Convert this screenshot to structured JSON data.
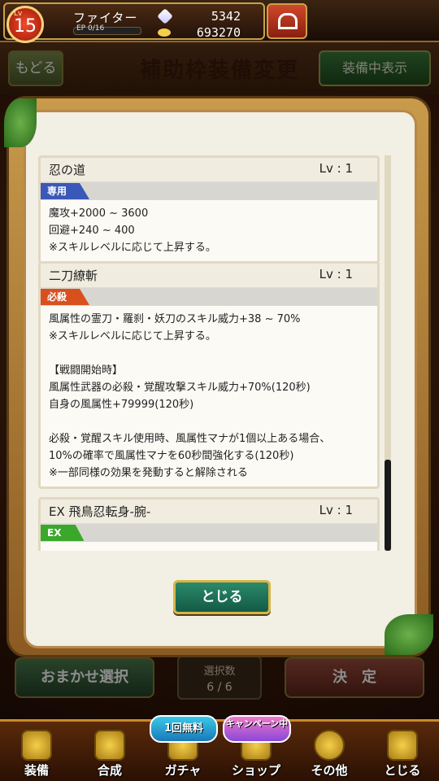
{
  "player": {
    "level_tag": "Lv",
    "level": "15",
    "job": "ファイター",
    "ep_label": "EP",
    "ep_value": "0/16",
    "ep_fraction": 0,
    "gems": "5342",
    "coins": "693270"
  },
  "header": {
    "back_label": "もどる",
    "title": "補助枠装備変更",
    "equipped_toggle_label": "装備中表示"
  },
  "selection": {
    "auto_select_label": "おまかせ選択",
    "count_label": "選択数",
    "count_value": "6 / 6",
    "confirm_label": "決　定"
  },
  "modal": {
    "close_label": "とじる",
    "skills": [
      {
        "name": "忍の道",
        "level": "Lv : 1",
        "type": "専用",
        "type_color": "#3a58b8",
        "lines": [
          "魔攻+2000 ~ 3600",
          "回避+240 ~ 400",
          "※スキルレベルに応じて上昇する。"
        ]
      },
      {
        "name": "二刀繚斬",
        "level": "Lv : 1",
        "type": "必殺",
        "type_color": "#d8501e",
        "lines": [
          "風属性の霊刀・羅刹・妖刀のスキル威力+38 ~ 70%",
          "※スキルレベルに応じて上昇する。",
          "",
          "【戦闘開始時】",
          "風属性武器の必殺・覚醒攻撃スキル威力+70%(120秒)",
          "自身の風属性+79999(120秒)",
          "",
          "必殺・覚醒スキル使用時、風属性マナが1個以上ある場合、",
          "10%の確率で風属性マナを60秒間強化する(120秒)",
          "※一部同様の効果を発動すると解除される"
        ]
      },
      {
        "name": "EX 飛鳥忍転身-腕-",
        "level": "Lv : 1",
        "type": "EX",
        "type_color": "#3aa82a",
        "lines": []
      }
    ]
  },
  "nav": [
    {
      "label": "装備",
      "icon": "equipment-icon"
    },
    {
      "label": "合成",
      "icon": "hammer-icon"
    },
    {
      "label": "ガチャ",
      "icon": "gacha-icon",
      "badge": "1回無料"
    },
    {
      "label": "ショップ",
      "icon": "shop-icon",
      "badge": "キャンペーン中"
    },
    {
      "label": "その他",
      "icon": "gear-icon"
    },
    {
      "label": "とじる",
      "icon": "close-statue-icon"
    }
  ],
  "colors": {
    "accent_gold": "#c9a24a",
    "close_button": "#2a8a6a"
  }
}
